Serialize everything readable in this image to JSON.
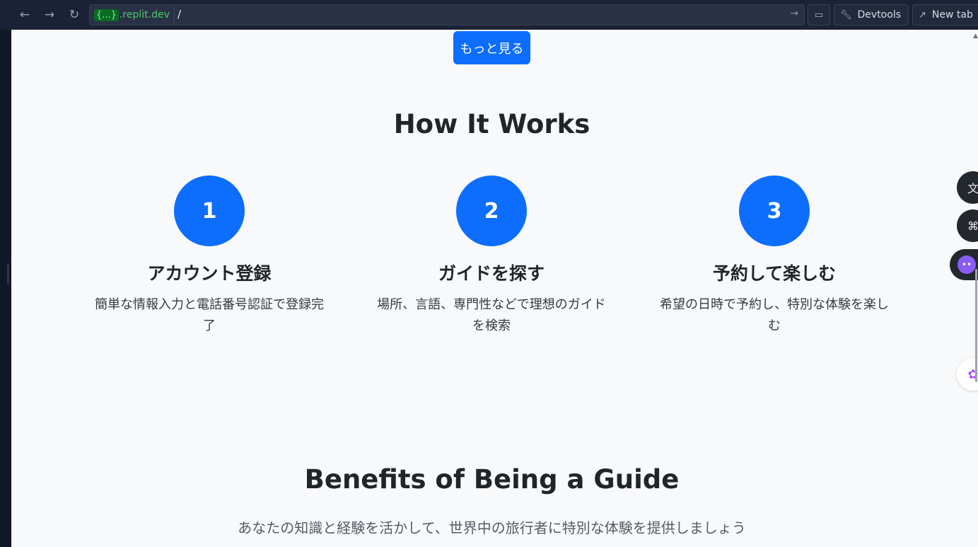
{
  "browser": {
    "back_icon": "arrow-left-icon",
    "forward_icon": "arrow-right-icon",
    "reload_icon": "reload-icon",
    "url_badge": "{...}",
    "url_host": ".replit.dev",
    "url_path": "/",
    "go_icon": "arrow-right-icon",
    "devtools_label": "Devtools",
    "newtab_label": "New tab"
  },
  "page": {
    "more_button": "もっと見る",
    "how_it_works": {
      "title": "How It Works",
      "steps": [
        {
          "number": "1",
          "title": "アカウント登録",
          "description": "簡単な情報入力と電話番号認証で登録完了"
        },
        {
          "number": "2",
          "title": "ガイドを探す",
          "description": "場所、言語、専門性などで理想のガイドを検索"
        },
        {
          "number": "3",
          "title": "予約して楽しむ",
          "description": "希望の日時で予約し、特別な体験を楽しむ"
        }
      ]
    },
    "benefits": {
      "title": "Benefits of Being a Guide",
      "subtitle": "あなたの知識と経験を活かして、世界中の旅行者に特別な体験を提供しましょう"
    }
  },
  "colors": {
    "primary": "#0d6efd",
    "page_background": "#f8f9fb",
    "heading": "#212529"
  }
}
